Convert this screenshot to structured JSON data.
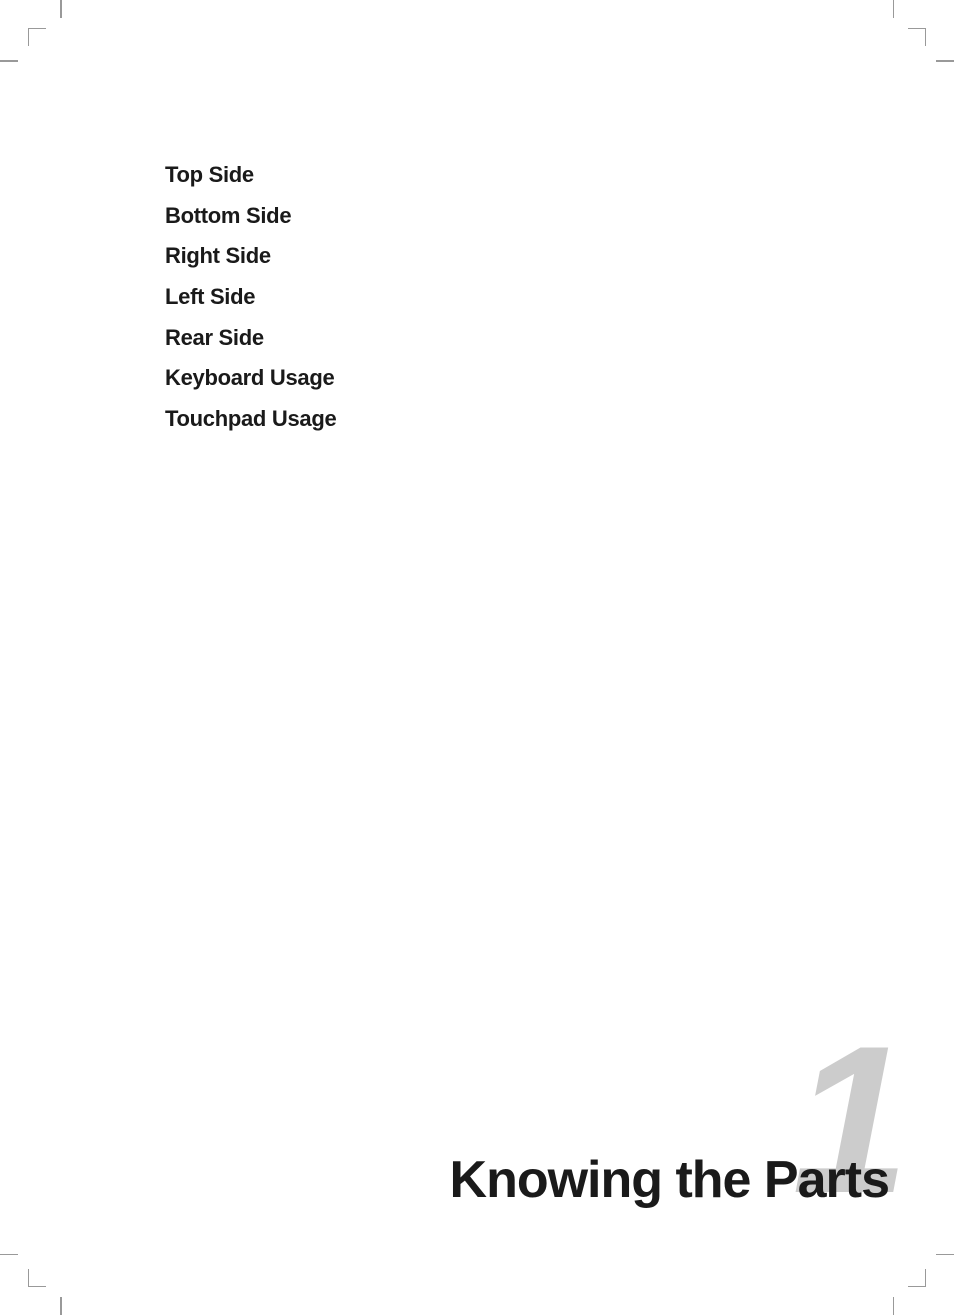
{
  "page": {
    "background": "#ffffff"
  },
  "toc": {
    "items": [
      {
        "label": "Top Side"
      },
      {
        "label": "Bottom Side"
      },
      {
        "label": "Right Side"
      },
      {
        "label": "Left Side"
      },
      {
        "label": "Rear Side"
      },
      {
        "label": "Keyboard Usage"
      },
      {
        "label": "Touchpad Usage"
      }
    ]
  },
  "chapter": {
    "number": "1",
    "title": "Knowing the Parts"
  }
}
